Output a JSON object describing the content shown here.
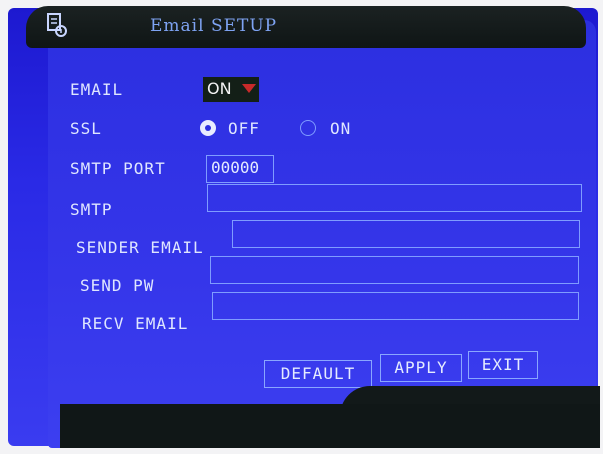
{
  "window": {
    "title": "Email SETUP",
    "icon": "email-setup-icon"
  },
  "rows": {
    "email": {
      "label": "EMAIL",
      "value": "ON"
    },
    "ssl": {
      "label": "SSL",
      "option_off": "OFF",
      "option_on": "ON",
      "selected": "OFF"
    },
    "smtp_port": {
      "label": "SMTP PORT",
      "value": "00000"
    },
    "smtp": {
      "label": "SMTP",
      "value": ""
    },
    "sender_email": {
      "label": "SENDER EMAIL",
      "value": ""
    },
    "send_pw": {
      "label": "SEND PW",
      "value": ""
    },
    "recv_email": {
      "label": "RECV EMAIL",
      "value": ""
    }
  },
  "buttons": {
    "default": "DEFAULT",
    "apply": "APPLY",
    "exit": "EXIT"
  },
  "colors": {
    "background": "#2c2fe0",
    "titlebar": "#141b1b",
    "dropdown_arrow": "#c82a2a",
    "field_border": "#7f9cff"
  }
}
